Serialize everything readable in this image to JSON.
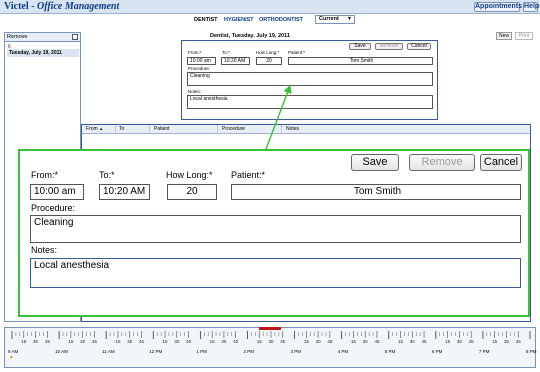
{
  "app": {
    "brand": "Victel",
    "separator": "-",
    "subtitle": "Office Management",
    "appointments_label": "Appointments",
    "help_label": "Help"
  },
  "tabs": [
    "DENTIST",
    "HYGIENIST",
    "ORTHODONTIST"
  ],
  "view_select": "Current",
  "left_panel": {
    "remove_label": "Remove",
    "day_number": "6",
    "selected_date": "Tuesday, July 19, 2011"
  },
  "day_header": "Dentist, Tuesday, July 19, 2011",
  "toolbar": {
    "new_label": "New",
    "print_label": "Print"
  },
  "form": {
    "from_label": "From:",
    "to_label": "To:",
    "how_long_label": "How Long:",
    "patient_label": "Patient:",
    "required_mark": "*",
    "from_value": "10:00 am",
    "to_value": "10:20 AM",
    "how_long_value": "20",
    "patient_value": "Tom Smith",
    "procedure_label": "Procedure:",
    "procedure_value": "Cleaning",
    "notes_label": "Notes:",
    "notes_value": "Local anesthesia",
    "save_label": "Save",
    "remove_label": "Remove",
    "cancel_label": "Cancel"
  },
  "table": {
    "columns": [
      "From",
      "To",
      "Patient",
      "Procedure",
      "Notes"
    ],
    "sort_indicator": "▲"
  },
  "timeline": {
    "minute_labels": [
      "15",
      "30",
      "45"
    ],
    "hours": [
      "9 AM",
      "10 AM",
      "11 AM",
      "12 PM",
      "1 PM",
      "2 PM",
      "3 PM",
      "4 PM",
      "5 PM",
      "6 PM",
      "7 PM",
      "8 PM"
    ]
  },
  "colors": {
    "highlight_border": "#38c038",
    "frame_blue": "#3a5a9a",
    "title_blue": "#0a3d8a",
    "now_marker": "#c01818"
  }
}
